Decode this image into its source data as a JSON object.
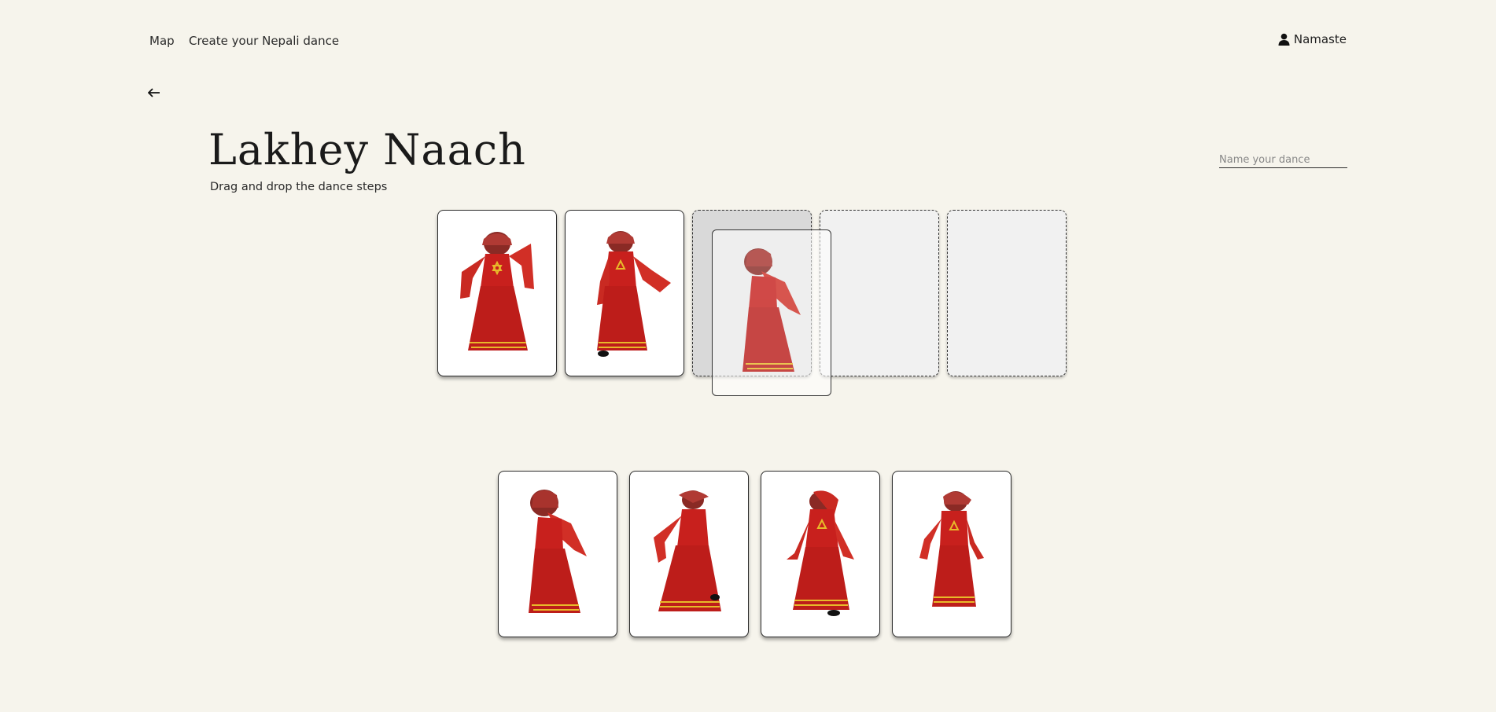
{
  "nav": {
    "map_label": "Map",
    "create_label": "Create your Nepali dance",
    "user_label": "Namaste"
  },
  "page": {
    "title": "Lakhey Naach",
    "subtitle": "Drag and drop the dance steps"
  },
  "name_field": {
    "placeholder": "Name your dance"
  },
  "sequence": {
    "filled_cards": [
      "lakhey-step-1",
      "lakhey-step-2"
    ],
    "empty_slots": 3,
    "hovered_slot": 3,
    "dragging_card": "lakhey-step-3"
  },
  "palette": {
    "cards": [
      "lakhey-step-3",
      "lakhey-step-4",
      "lakhey-step-5",
      "lakhey-step-6"
    ]
  },
  "colors": {
    "background": "#f6f4ec",
    "costume_red": "#c8201d",
    "costume_gold": "#e8b92a"
  }
}
